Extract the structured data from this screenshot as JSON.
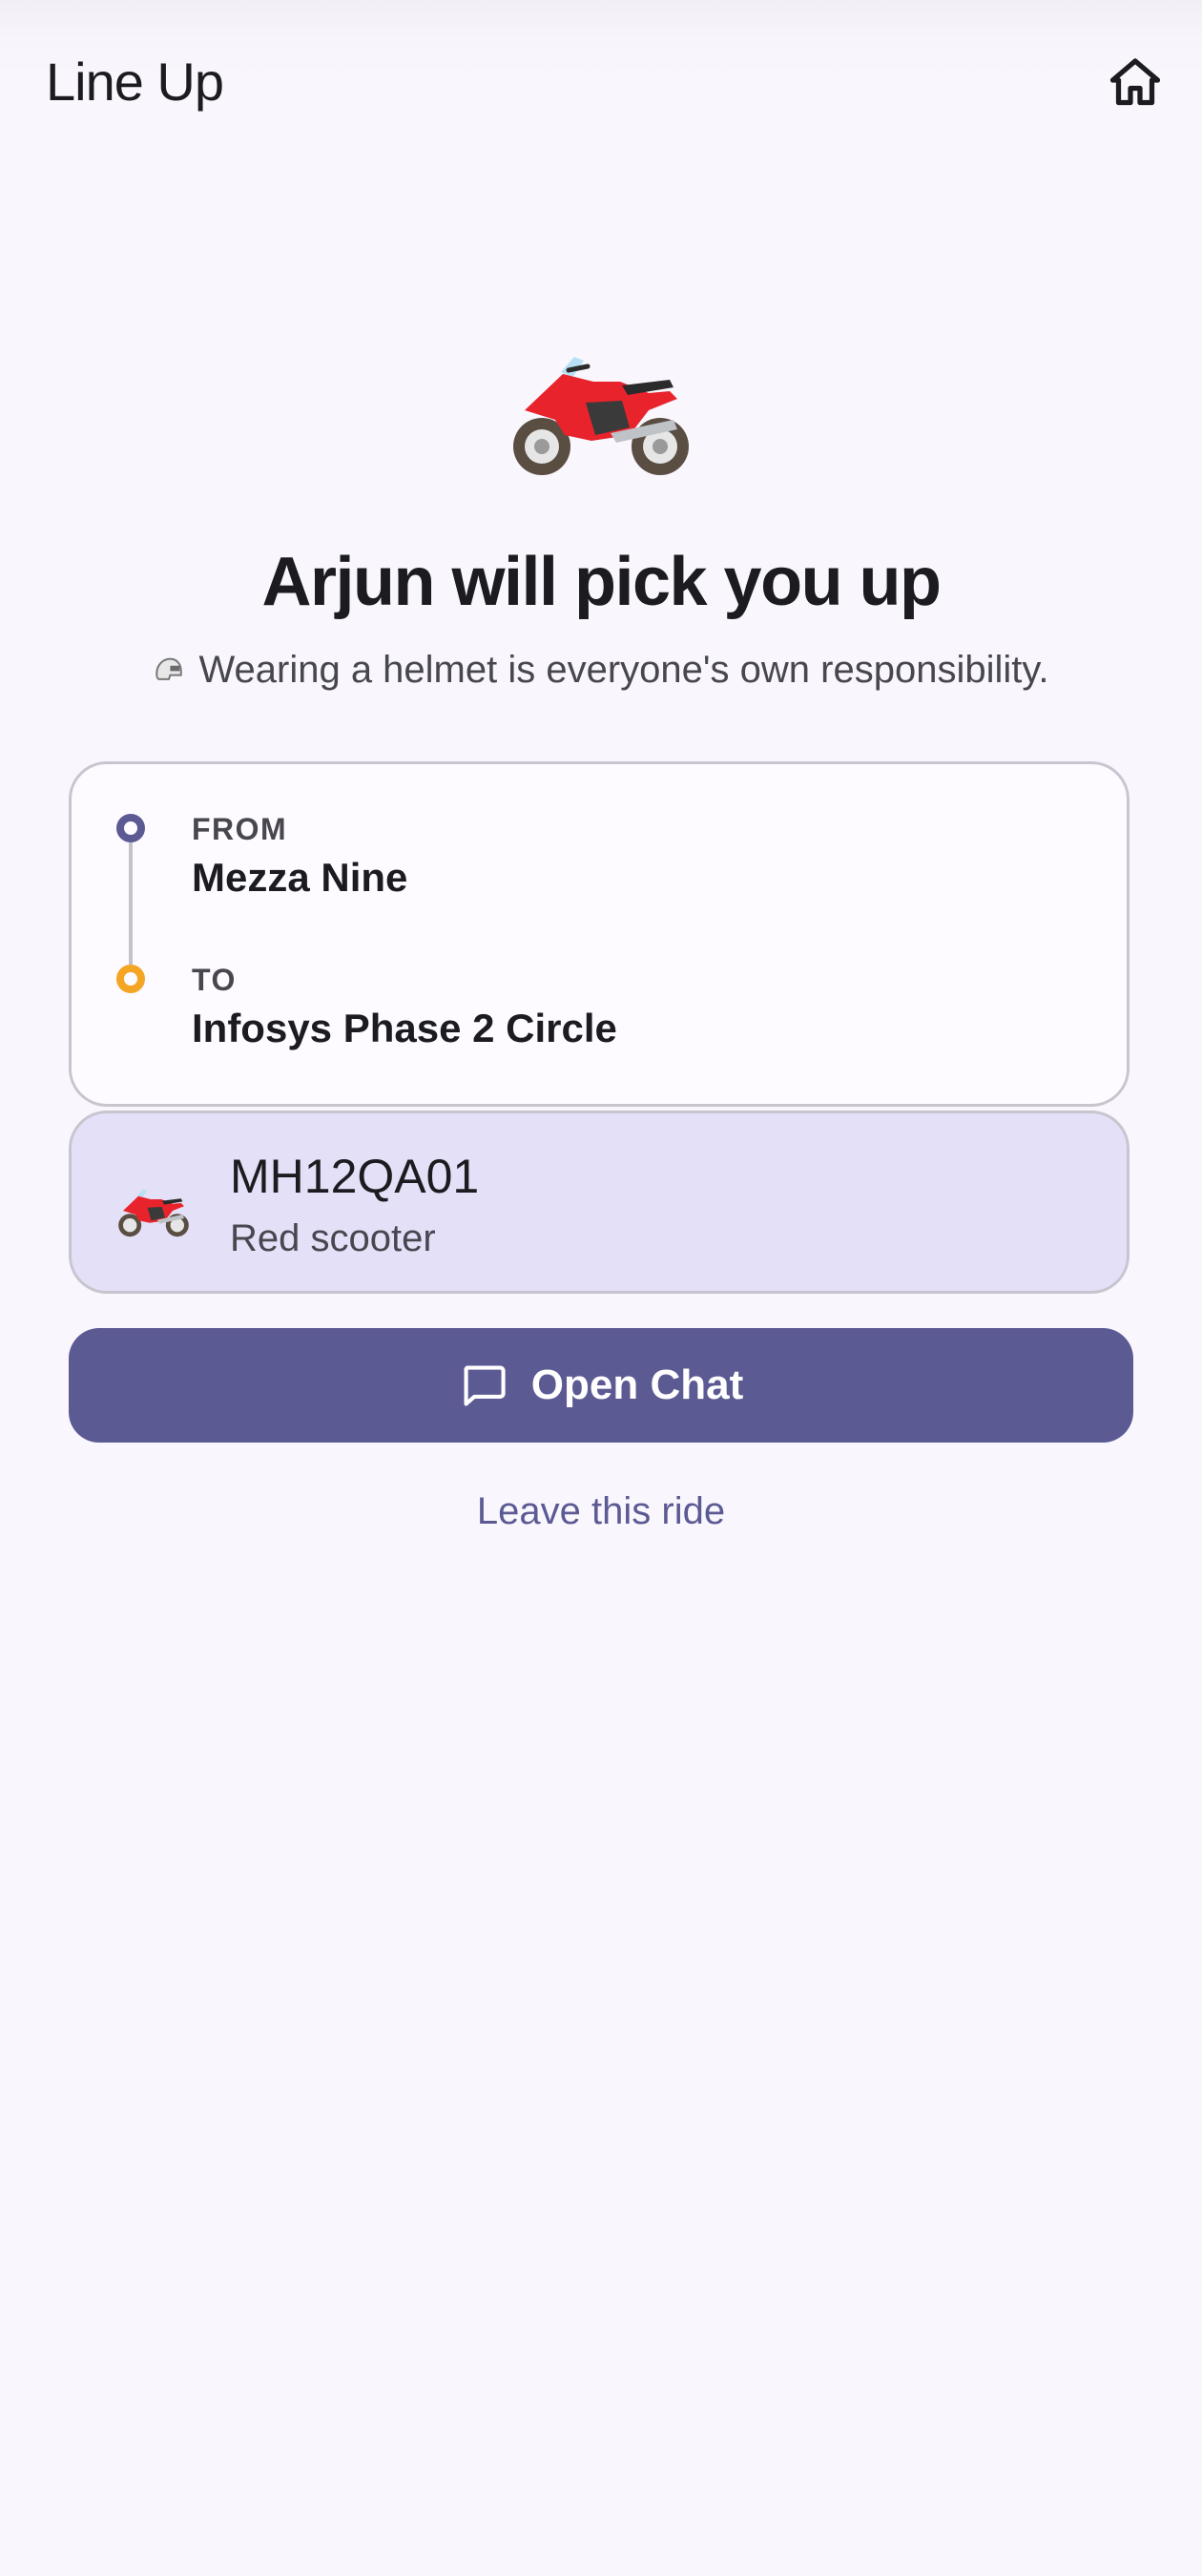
{
  "app_bar": {
    "title": "Line Up",
    "home_icon": "home-icon"
  },
  "hero": {
    "icon": "motorcycle-icon",
    "headline": "Arjun will pick you up",
    "helmet_icon": "helmet-icon",
    "helmet_note": "Wearing a helmet is everyone's own responsibility."
  },
  "route": {
    "from_label": "FROM",
    "from_value": "Mezza Nine",
    "to_label": "TO",
    "to_value": "Infosys Phase 2 Circle"
  },
  "vehicle": {
    "icon": "motorcycle-icon",
    "plate": "MH12QA01",
    "description": "Red scooter"
  },
  "actions": {
    "chat_icon": "chat-bubble-icon",
    "open_chat_label": "Open Chat",
    "leave_label": "Leave this ride"
  },
  "colors": {
    "primary": "#5c5a93",
    "from_dot": "#5c5a93",
    "to_dot": "#f5a524",
    "vehicle_card_bg": "#e3e0f7",
    "background": "#f9f7fd"
  }
}
